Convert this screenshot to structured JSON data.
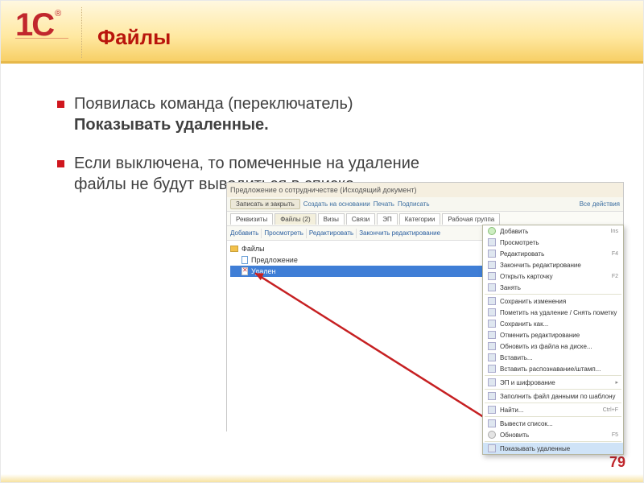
{
  "header": {
    "title": "Файлы"
  },
  "bullets": [
    {
      "pre": "Появилась команда (переключатель) ",
      "bold": "Показывать удаленные."
    },
    {
      "pre": "Если выключена, то помеченные на удаление файлы не будут выводиться в списке.",
      "bold": ""
    }
  ],
  "screenshot": {
    "window_title": "Предложение о сотрудничестве (Исходящий документ)",
    "toolbar": {
      "save_close": "Записать и закрыть",
      "save": "Создать на основании",
      "print": "Печать",
      "sign": "Подписать",
      "all_actions": "Все действия"
    },
    "tabs": {
      "tab1": "Реквизиты",
      "tab2": "Файлы (2)",
      "tab3": "Визы",
      "tab4": "Связи",
      "tab5": "ЭП",
      "tab6": "Категории",
      "tab7": "Рабочая группа"
    },
    "sub": {
      "add": "Добавить",
      "view": "Просмотреть",
      "edit": "Редактировать",
      "finish": "Закончить редактирование",
      "actions": "Все действия"
    },
    "tree": {
      "root": "Файлы",
      "n1": "Предложение",
      "n2": "Удален"
    },
    "menu": {
      "m1": "Добавить",
      "m1k": "Ins",
      "m2": "Просмотреть",
      "m3": "Редактировать",
      "m3k": "F4",
      "m4": "Закончить редактирование",
      "m5": "Открыть карточку",
      "m5k": "F2",
      "m6": "Занять",
      "m7": "Сохранить изменения",
      "m8": "Пометить на удаление / Снять пометку",
      "m9": "Сохранить как...",
      "m10": "Отменить редактирование",
      "m11": "Обновить из файла на диске...",
      "m12": "Вставить...",
      "m13": "Вставить распознавание/штамп...",
      "m14": "ЭП и шифрование",
      "m15": "Заполнить файл данными по шаблону",
      "m16": "Найти...",
      "m16k": "Ctrl+F",
      "m17": "Вывести список...",
      "m18": "Обновить",
      "m18k": "F5",
      "m19": "Показывать удаленные"
    }
  },
  "page": {
    "num": "79"
  }
}
